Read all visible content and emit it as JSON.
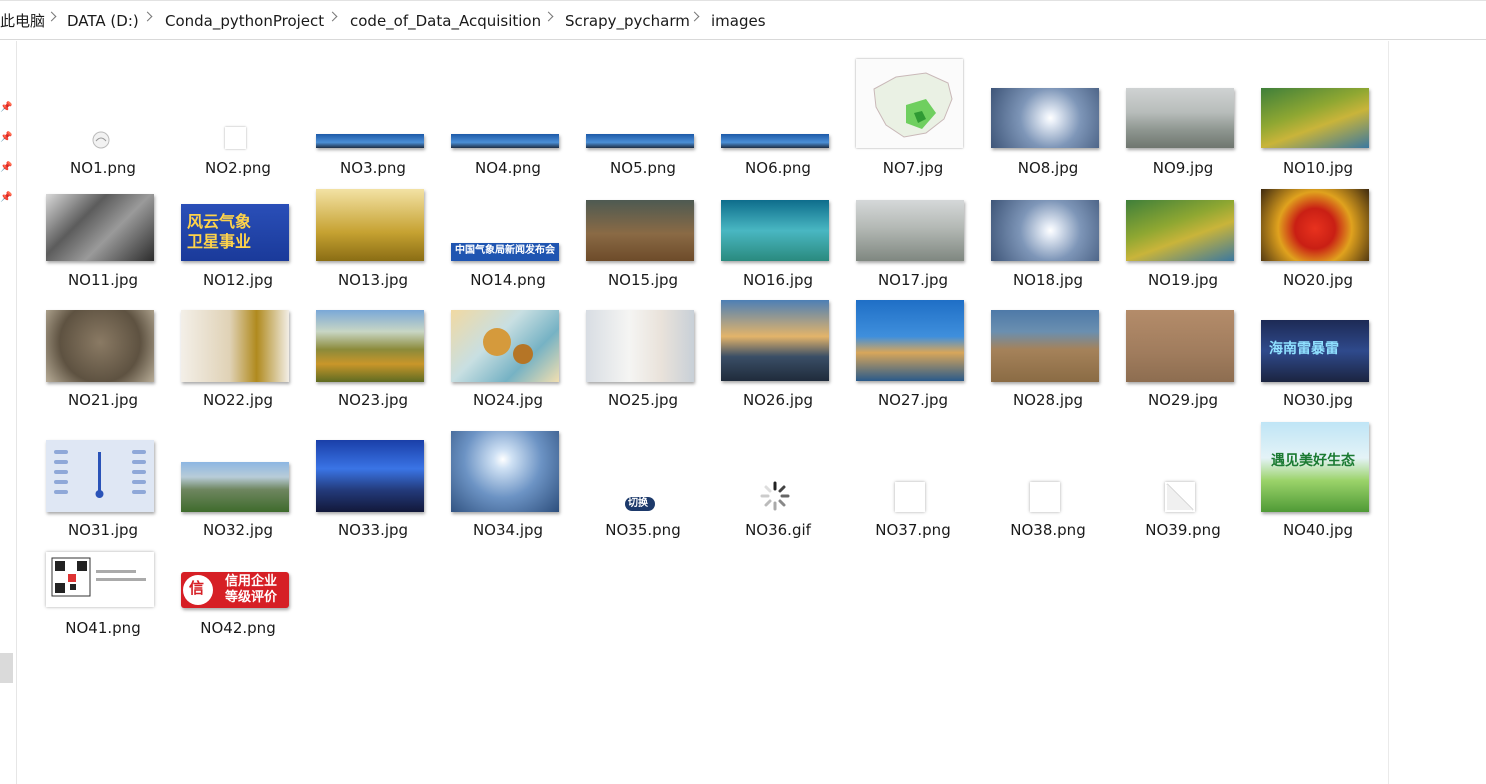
{
  "breadcrumb": [
    "此电脑",
    "DATA (D:)",
    "Conda_pythonProject",
    "code_of_Data_Acquisition",
    "Scrapy_pycharm",
    "images"
  ],
  "files": [
    {
      "name": "NO1.png"
    },
    {
      "name": "NO2.png"
    },
    {
      "name": "NO3.png"
    },
    {
      "name": "NO4.png"
    },
    {
      "name": "NO5.png"
    },
    {
      "name": "NO6.png"
    },
    {
      "name": "NO7.jpg"
    },
    {
      "name": "NO8.jpg"
    },
    {
      "name": "NO9.jpg"
    },
    {
      "name": "NO10.jpg"
    },
    {
      "name": "NO11.jpg"
    },
    {
      "name": "NO12.jpg"
    },
    {
      "name": "NO13.jpg"
    },
    {
      "name": "NO14.png"
    },
    {
      "name": "NO15.jpg"
    },
    {
      "name": "NO16.jpg"
    },
    {
      "name": "NO17.jpg"
    },
    {
      "name": "NO18.jpg"
    },
    {
      "name": "NO19.jpg"
    },
    {
      "name": "NO20.jpg"
    },
    {
      "name": "NO21.jpg"
    },
    {
      "name": "NO22.jpg"
    },
    {
      "name": "NO23.jpg"
    },
    {
      "name": "NO24.jpg"
    },
    {
      "name": "NO25.jpg"
    },
    {
      "name": "NO26.jpg"
    },
    {
      "name": "NO27.jpg"
    },
    {
      "name": "NO28.jpg"
    },
    {
      "name": "NO29.jpg"
    },
    {
      "name": "NO30.jpg"
    },
    {
      "name": "NO31.jpg"
    },
    {
      "name": "NO32.jpg"
    },
    {
      "name": "NO33.jpg"
    },
    {
      "name": "NO34.jpg"
    },
    {
      "name": "NO35.png"
    },
    {
      "name": "NO36.gif"
    },
    {
      "name": "NO37.png"
    },
    {
      "name": "NO38.png"
    },
    {
      "name": "NO39.png"
    },
    {
      "name": "NO40.jpg"
    },
    {
      "name": "NO41.png"
    },
    {
      "name": "NO42.png"
    }
  ],
  "thumb_text": {
    "no12_line1": "风云气象",
    "no12_line2": "卫星事业",
    "no14_banner": "中国气象局新闻发布会",
    "no30_text": "海南雷暴雷",
    "no35_button": "切换",
    "no40_text": "遇见美好生态",
    "no42_line1": "信用企业",
    "no42_line2": "等级评价",
    "no42_badge": "信"
  }
}
